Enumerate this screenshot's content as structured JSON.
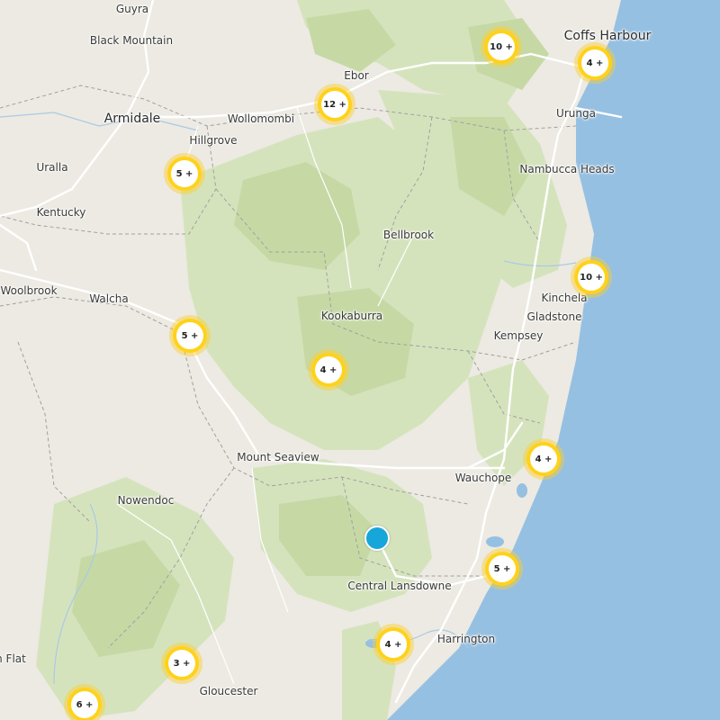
{
  "map": {
    "colors": {
      "land": "#eceae2",
      "forest": "#c8dba9",
      "forest_light": "#d9e6c2",
      "water": "#96c0e2",
      "road": "#ffffff",
      "border": "#999999"
    },
    "places": [
      {
        "name": "Guyra",
        "major": false
      },
      {
        "name": "Black Mountain",
        "major": false
      },
      {
        "name": "Armidale",
        "major": true
      },
      {
        "name": "Wollomombi",
        "major": false
      },
      {
        "name": "Hillgrove",
        "major": false
      },
      {
        "name": "Uralla",
        "major": false
      },
      {
        "name": "Kentucky",
        "major": false
      },
      {
        "name": "Ebor",
        "major": false
      },
      {
        "name": "Coffs Harbour",
        "major": true
      },
      {
        "name": "Urunga",
        "major": false
      },
      {
        "name": "Nambucca Heads",
        "major": false
      },
      {
        "name": "Bellbrook",
        "major": false
      },
      {
        "name": "Woolbrook",
        "major": false
      },
      {
        "name": "Walcha",
        "major": false
      },
      {
        "name": "Kookaburra",
        "major": false
      },
      {
        "name": "Kinchela",
        "major": false
      },
      {
        "name": "Gladstone",
        "major": false
      },
      {
        "name": "Kempsey",
        "major": false
      },
      {
        "name": "Mount Seaview",
        "major": false
      },
      {
        "name": "Wauchope",
        "major": false
      },
      {
        "name": "Nowendoc",
        "major": false
      },
      {
        "name": "Central Lansdowne",
        "major": false
      },
      {
        "name": "Harrington",
        "major": false
      },
      {
        "name": "n Flat",
        "major": false
      },
      {
        "name": "Gloucester",
        "major": false
      }
    ],
    "clusters": [
      {
        "label": "10 +",
        "count": 10
      },
      {
        "label": "4 +",
        "count": 4
      },
      {
        "label": "12 +",
        "count": 12
      },
      {
        "label": "5 +",
        "count": 5
      },
      {
        "label": "10 +",
        "count": 10
      },
      {
        "label": "5 +",
        "count": 5
      },
      {
        "label": "4 +",
        "count": 4
      },
      {
        "label": "4 +",
        "count": 4
      },
      {
        "label": "5 +",
        "count": 5
      },
      {
        "label": "4 +",
        "count": 4
      },
      {
        "label": "3 +",
        "count": 3
      },
      {
        "label": "6 +",
        "count": 6
      }
    ],
    "marker": {
      "color": "#16a6d9"
    }
  }
}
